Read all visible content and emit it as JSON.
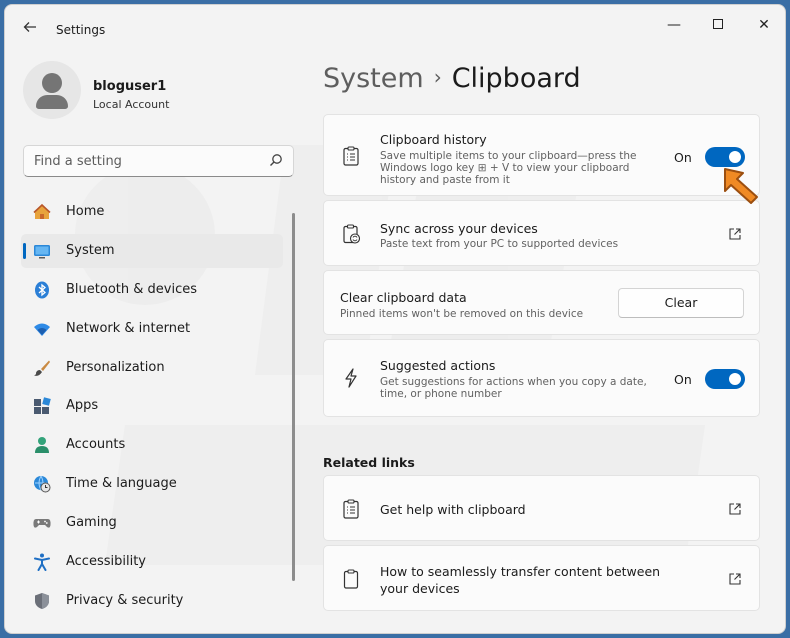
{
  "window": {
    "app_title": "Settings",
    "controls": {
      "minimize": "—",
      "close": "✕"
    }
  },
  "profile": {
    "username": "bloguser1",
    "account_type": "Local Account"
  },
  "search": {
    "placeholder": "Find a setting"
  },
  "sidebar": {
    "items": [
      {
        "label": "Home",
        "icon": "home-icon"
      },
      {
        "label": "System",
        "icon": "system-icon",
        "active": true
      },
      {
        "label": "Bluetooth & devices",
        "icon": "bluetooth-icon"
      },
      {
        "label": "Network & internet",
        "icon": "wifi-icon"
      },
      {
        "label": "Personalization",
        "icon": "brush-icon"
      },
      {
        "label": "Apps",
        "icon": "apps-icon"
      },
      {
        "label": "Accounts",
        "icon": "person-icon"
      },
      {
        "label": "Time & language",
        "icon": "clock-globe-icon"
      },
      {
        "label": "Gaming",
        "icon": "gamepad-icon"
      },
      {
        "label": "Accessibility",
        "icon": "accessibility-icon"
      },
      {
        "label": "Privacy & security",
        "icon": "shield-icon"
      }
    ]
  },
  "breadcrumb": {
    "parent": "System",
    "separator": "›",
    "current": "Clipboard"
  },
  "settings": {
    "clipboard_history": {
      "title": "Clipboard history",
      "description": "Save multiple items to your clipboard—press the Windows logo key ⊞ + V to view your clipboard history and paste from it",
      "state_label": "On",
      "enabled": true
    },
    "sync_devices": {
      "title": "Sync across your devices",
      "description": "Paste text from your PC to supported devices"
    },
    "clear_data": {
      "title": "Clear clipboard data",
      "description": "Pinned items won't be removed on this device",
      "button_label": "Clear"
    },
    "suggested_actions": {
      "title": "Suggested actions",
      "description": "Get suggestions for actions when you copy a date, time, or phone number",
      "state_label": "On",
      "enabled": true
    }
  },
  "related_links": {
    "heading": "Related links",
    "items": [
      {
        "label": "Get help with clipboard"
      },
      {
        "label": "How to seamlessly transfer content between your devices"
      }
    ]
  },
  "colors": {
    "accent": "#0067c0",
    "annotation_arrow": "#f08a24"
  }
}
